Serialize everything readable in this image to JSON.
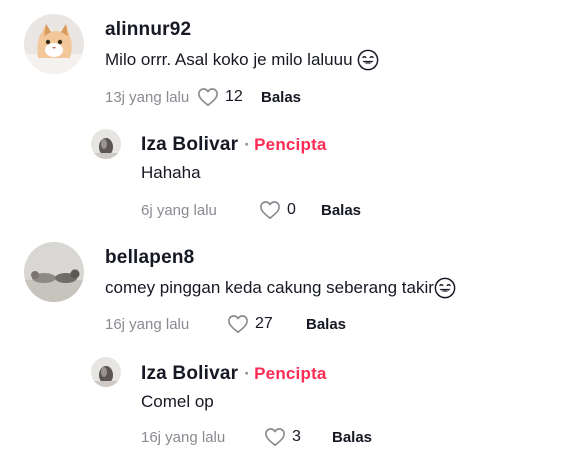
{
  "comments": [
    {
      "username": "alinnur92",
      "text": "Milo orrr. Asal koko je milo laluuu",
      "emoji": "tears-of-joy-emoji",
      "time": "13j yang lalu",
      "likes": "12",
      "reply": "Balas",
      "reply_item": {
        "username": "Iza Bolivar",
        "separator": "·",
        "badge": "Pencipta",
        "text": "Hahaha",
        "time": "6j yang lalu",
        "likes": "0",
        "reply": "Balas"
      }
    },
    {
      "username": "bellapen8",
      "text": "comey pinggan keda cakung seberang takir",
      "emoji": "tears-of-joy-emoji",
      "time": "16j yang lalu",
      "likes": "27",
      "reply": "Balas",
      "reply_item": {
        "username": "Iza Bolivar",
        "separator": "·",
        "badge": "Pencipta",
        "text": "Comel op",
        "time": "16j yang lalu",
        "likes": "3",
        "reply": "Balas"
      }
    }
  ],
  "colors": {
    "creator_badge": "#fe2c55",
    "meta_gray": "#8a8b91",
    "text_dark": "#161823"
  }
}
